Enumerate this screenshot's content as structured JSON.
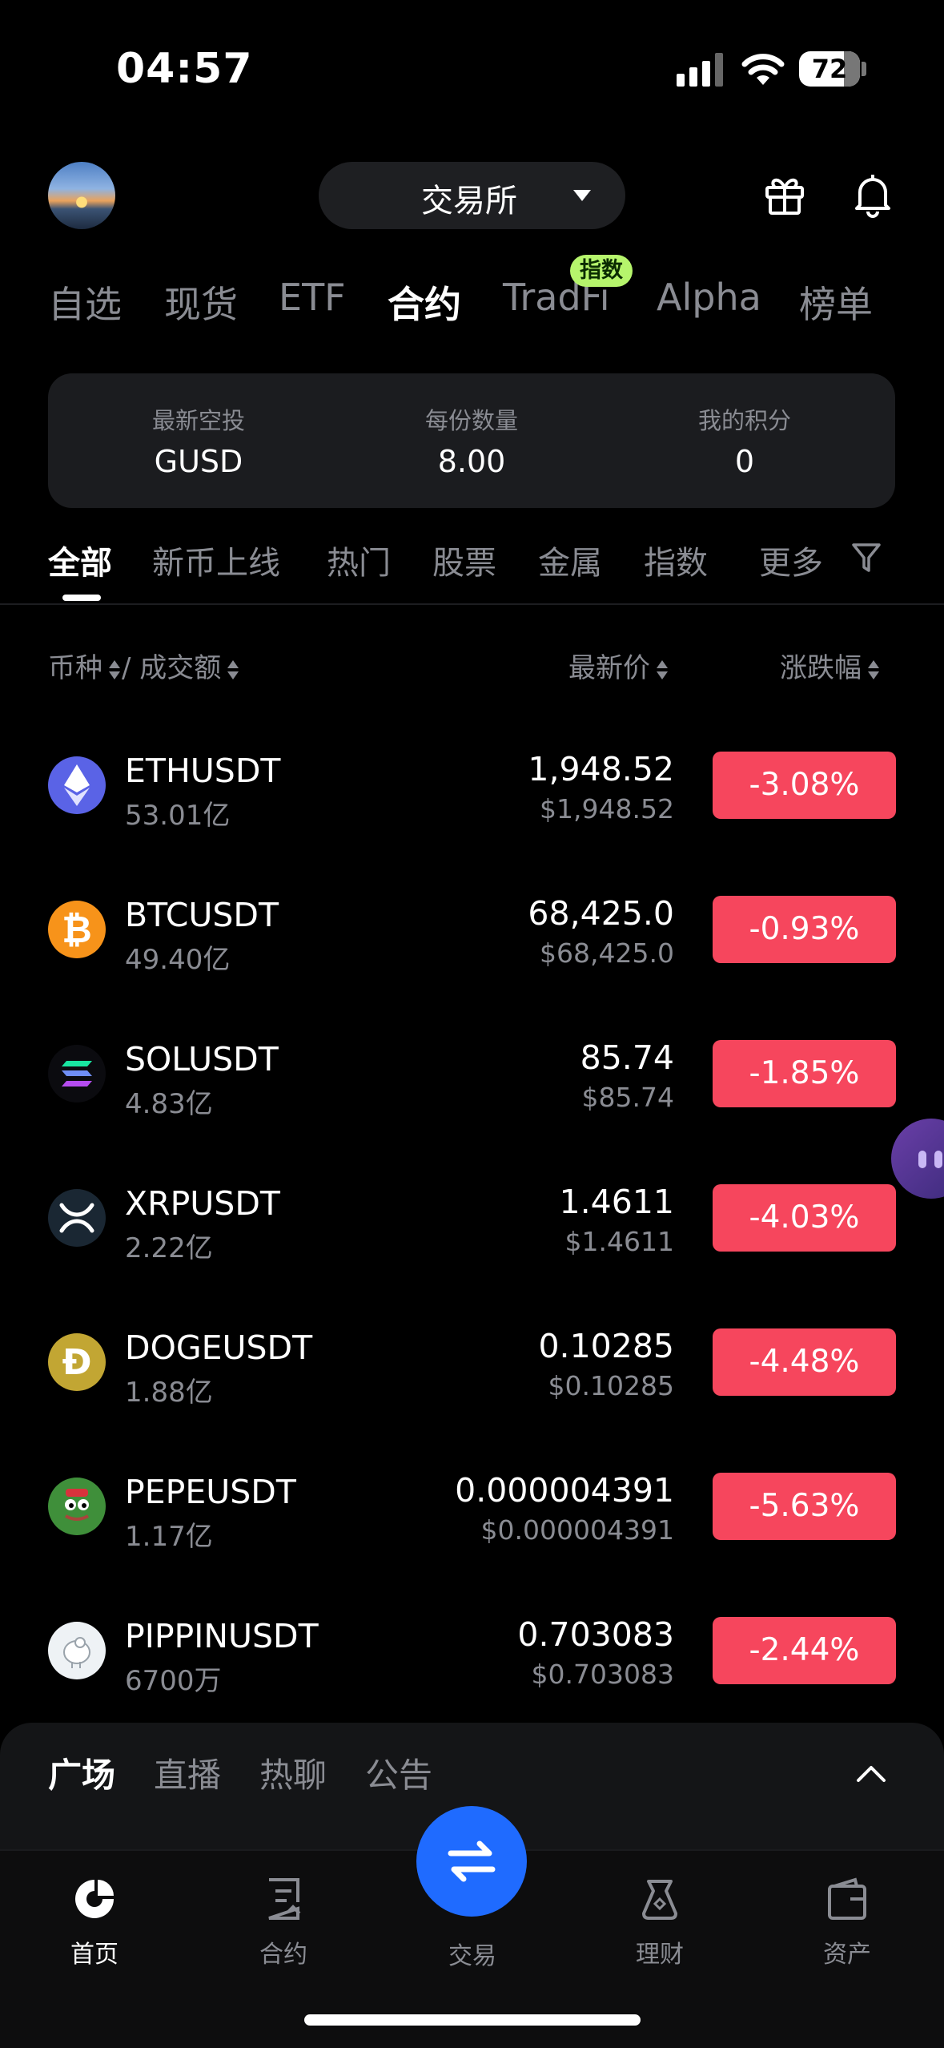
{
  "status_bar": {
    "time": "04:57",
    "battery": "72"
  },
  "header": {
    "exchange_label": "交易所"
  },
  "market_tabs": [
    {
      "label": "自选"
    },
    {
      "label": "现货"
    },
    {
      "label": "ETF"
    },
    {
      "label": "合约"
    },
    {
      "label": "TradFi"
    },
    {
      "label": "Alpha"
    },
    {
      "label": "榜单"
    }
  ],
  "market_tab_badge": "指数",
  "airdrop_card": [
    {
      "key": "最新空投",
      "value": "GUSD"
    },
    {
      "key": "每份数量",
      "value": "8.00"
    },
    {
      "key": "我的积分",
      "value": "0"
    }
  ],
  "filter_tabs": [
    {
      "label": "全部"
    },
    {
      "label": "新币上线"
    },
    {
      "label": "热门"
    },
    {
      "label": "股票"
    },
    {
      "label": "金属"
    },
    {
      "label": "指数"
    },
    {
      "label": "更多"
    }
  ],
  "columns": {
    "coin": "币种",
    "separator": "/",
    "volume": "成交额",
    "price": "最新价",
    "change": "涨跌幅"
  },
  "rows": [
    {
      "symbol": "ETHUSDT",
      "volume": "53.01亿",
      "price": "1,948.52",
      "usd": "$1,948.52",
      "change": "-3.08%"
    },
    {
      "symbol": "BTCUSDT",
      "volume": "49.40亿",
      "price": "68,425.0",
      "usd": "$68,425.0",
      "change": "-0.93%"
    },
    {
      "symbol": "SOLUSDT",
      "volume": "4.83亿",
      "price": "85.74",
      "usd": "$85.74",
      "change": "-1.85%"
    },
    {
      "symbol": "XRPUSDT",
      "volume": "2.22亿",
      "price": "1.4611",
      "usd": "$1.4611",
      "change": "-4.03%"
    },
    {
      "symbol": "DOGEUSDT",
      "volume": "1.88亿",
      "price": "0.10285",
      "usd": "$0.10285",
      "change": "-4.48%"
    },
    {
      "symbol": "PEPEUSDT",
      "volume": "1.17亿",
      "price": "0.000004391",
      "usd": "$0.000004391",
      "change": "-5.63%"
    },
    {
      "symbol": "PIPPINUSDT",
      "volume": "6700万",
      "price": "0.703083",
      "usd": "$0.703083",
      "change": "-2.44%"
    }
  ],
  "panel_tabs": [
    {
      "label": "广场"
    },
    {
      "label": "直播"
    },
    {
      "label": "热聊"
    },
    {
      "label": "公告"
    }
  ],
  "bottom_nav": [
    {
      "label": "首页",
      "icon": "home-icon"
    },
    {
      "label": "合约",
      "icon": "contract-icon"
    },
    {
      "label": "交易",
      "icon": "swap-icon"
    },
    {
      "label": "理财",
      "icon": "finance-icon"
    },
    {
      "label": "资产",
      "icon": "wallet-icon"
    }
  ],
  "colors": {
    "accent": "#1f6bff",
    "down": "#f6465d",
    "badge": "#b6f56c"
  }
}
